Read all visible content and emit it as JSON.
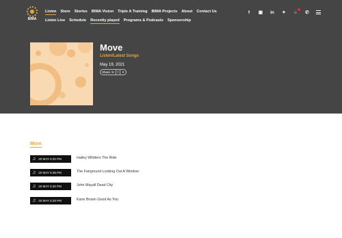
{
  "logo": {
    "text": "BIMA"
  },
  "nav_primary": [
    "Listen",
    "Store",
    "Stories",
    "BIMA Vision",
    "Triple A Training",
    "BIMA Projects",
    "About",
    "Contact Us"
  ],
  "nav_secondary": [
    "Listen Live",
    "Schedule",
    "Recently played",
    "Programs & Podcasts",
    "Sponsorship"
  ],
  "social_icons": [
    "facebook-icon",
    "instagram-icon",
    "linkedin-icon",
    "twitter-icon"
  ],
  "utility_icons": [
    "cart-icon",
    "phone-icon",
    "menu-icon"
  ],
  "song": {
    "title": "Move",
    "subtitle": "Listen/Latest Songs",
    "date": "May 19, 2021",
    "share_label": "Share"
  },
  "more_heading": "More",
  "recent": [
    {
      "time": "20 MAY 5:40 PM",
      "song": "Hailey Whitters The Ride"
    },
    {
      "time": "20 MAY 5:36 PM",
      "song": "The Fairground Looking Out A Window"
    },
    {
      "time": "20 MAY 5:30 PM",
      "song": "John Mayall Dead City"
    },
    {
      "time": "20 MAY 5:26 PM",
      "song": "Kane Brown Good As You"
    }
  ],
  "colors": {
    "accent": "#e8a43c",
    "hero_bg": "#454545",
    "cover_bg": "#f8d9b2"
  }
}
